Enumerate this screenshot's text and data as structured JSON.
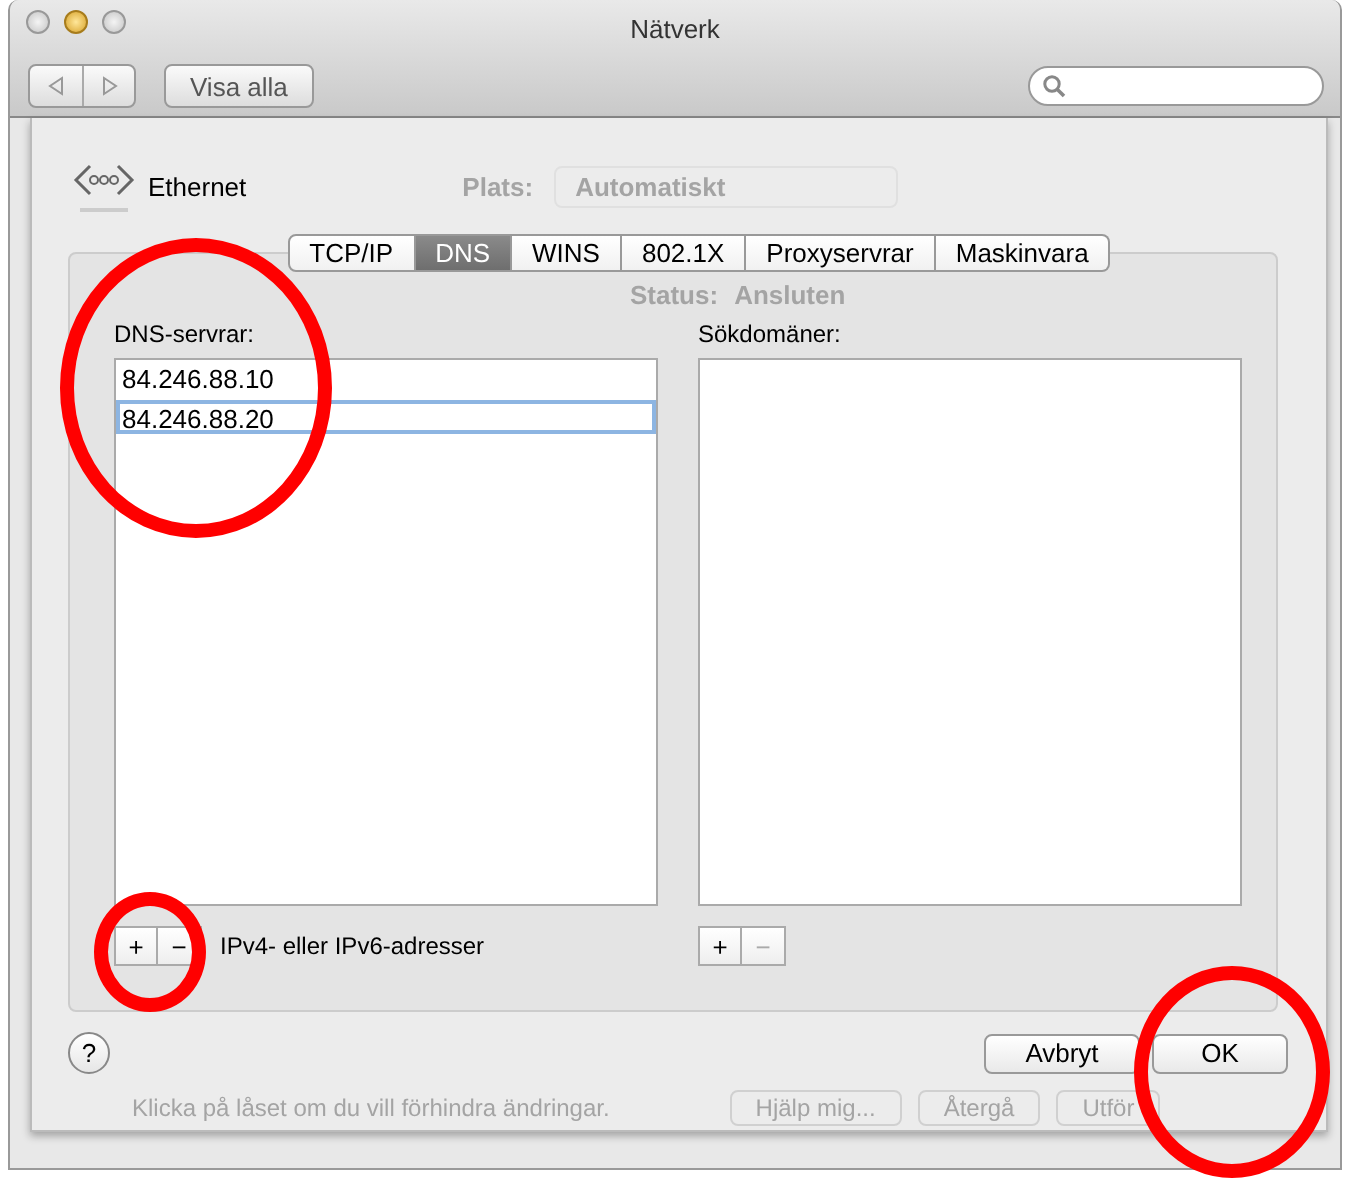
{
  "window": {
    "title": "Nätverk"
  },
  "toolbar": {
    "show_all_button": "Visa alla"
  },
  "service": {
    "name": "Ethernet"
  },
  "background": {
    "location_label": "Plats:",
    "location_value": "Automatiskt",
    "status_label": "Status:",
    "status_value": "Ansluten",
    "lock_hint": "Klicka på låset om du vill förhindra ändringar.",
    "buttons": [
      "Hjälp mig...",
      "Återgå",
      "Utför"
    ]
  },
  "tabs": [
    {
      "label": "TCP/IP",
      "selected": false
    },
    {
      "label": "DNS",
      "selected": true
    },
    {
      "label": "WINS",
      "selected": false
    },
    {
      "label": "802.1X",
      "selected": false
    },
    {
      "label": "Proxyservrar",
      "selected": false
    },
    {
      "label": "Maskinvara",
      "selected": false
    }
  ],
  "dns_servers": {
    "label": "DNS-servrar:",
    "entries": [
      {
        "value": "84.246.88.10",
        "selected": false
      },
      {
        "value": "84.246.88.20",
        "selected": true
      }
    ],
    "add": "+",
    "remove": "−",
    "remove_disabled": false,
    "hint": "IPv4- eller IPv6-adresser"
  },
  "search_domains": {
    "label": "Sökdomäner:",
    "add": "+",
    "remove": "−",
    "remove_disabled": true
  },
  "buttons": {
    "help": "?",
    "cancel": "Avbryt",
    "ok": "OK"
  },
  "annotations": [
    {
      "kind": "circle"
    },
    {
      "kind": "circle"
    },
    {
      "kind": "circle"
    }
  ]
}
